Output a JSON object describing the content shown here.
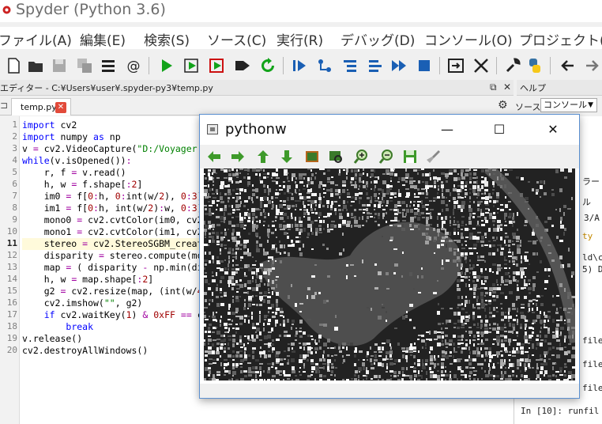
{
  "app": {
    "title": "Spyder (Python 3.6)"
  },
  "menu": [
    "ファイル(A)",
    "編集(E)",
    "検索(S)",
    "ソース(C)",
    "実行(R)",
    "デバッグ(D)",
    "コンソール(O)",
    "プロジェクト(P"
  ],
  "editor": {
    "path": "エディター - C:¥Users¥user¥.spyder-py3¥temp.py",
    "tab_label": "temp.py",
    "current_line": 11,
    "lines": [
      "import cv2",
      "import numpy as np",
      "v = cv2.VideoCapture(\"D:/Voyager",
      "while(v.isOpened()):",
      "    r, f = v.read()",
      "    h, w = f.shape[:2]",
      "    im0 = f[0:h, 0:int(w/2), 0:3]",
      "    im1 = f[0:h, int(w/2):w, 0:3]",
      "    mono0 = cv2.cvtColor(im0, cv2",
      "    mono1 = cv2.cvtColor(im1, cv2",
      "    stereo = cv2.StereoSGBM_creat",
      "    disparity = stereo.compute(mo",
      "    map = ( disparity - np.min(di",
      "    h, w = map.shape[:2]",
      "    g2 = cv2.resize(map, (int(w/4",
      "    cv2.imshow(\"\", g2)",
      "    if cv2.waitKey(1) & 0xFF == c",
      "        break",
      "v.release()",
      "cv2.destroyAllWindows()"
    ]
  },
  "help": {
    "title": "ヘルプ",
    "source_label": "ソース",
    "source_value": "コンソール"
  },
  "right_pane": {
    "snippets": [
      "ラー",
      "ル",
      "3/A",
      "ty",
      "ld\\c",
      "5) D",
      "file",
      "file",
      "file",
      "In [10]: runfil"
    ]
  },
  "pythonw": {
    "title": "pythonw",
    "minimize": "—",
    "maximize": "☐",
    "close": "✕"
  }
}
